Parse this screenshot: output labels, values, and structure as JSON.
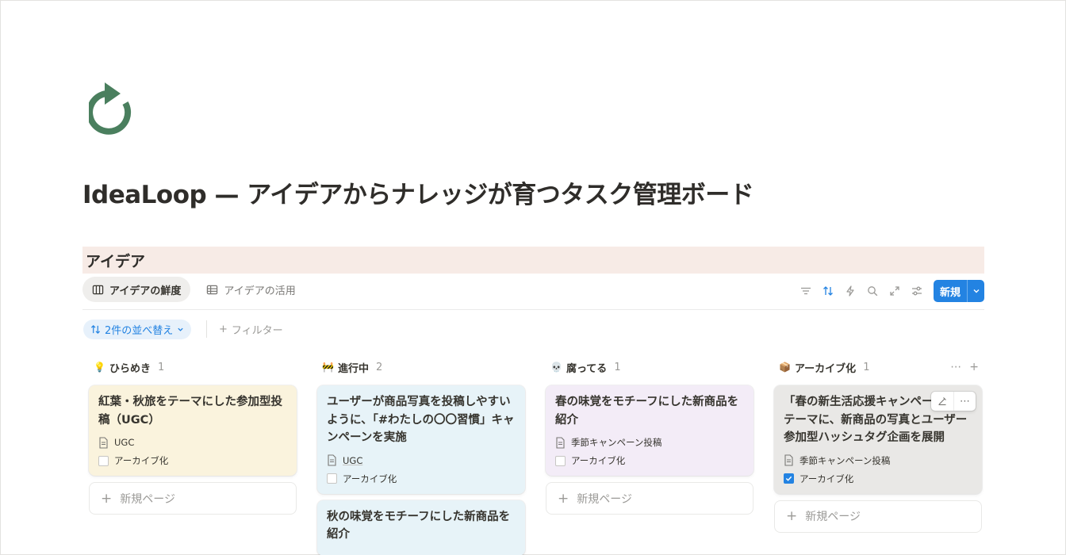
{
  "page": {
    "icon": "refresh-arrow-icon",
    "title": "IdeaLoop — アイデアからナレッジが育つタスク管理ボード"
  },
  "database": {
    "title": "アイデア",
    "views": [
      {
        "label": "アイデアの鮮度",
        "icon": "board-icon",
        "active": true
      },
      {
        "label": "アイデアの活用",
        "icon": "table-icon",
        "active": false
      }
    ],
    "new_button_label": "新規",
    "sort_chip_label": "2件の並べ替え",
    "filter_label": "フィルター"
  },
  "colors": {
    "accent": "#2383e2",
    "icon_green": "#4a7f5e",
    "db_title_bg": "#f7ebe6"
  },
  "columns": [
    {
      "emoji": "💡",
      "name": "ひらめき",
      "count": "1",
      "cards": [
        {
          "title": "紅葉・秋旅をテーマにした参加型投稿（UGC）",
          "tag": "UGC",
          "archive_label": "アーカイブ化",
          "archived": false,
          "bg": "#faf3dd"
        }
      ],
      "new_page_label": "新規ページ"
    },
    {
      "emoji": "🚧",
      "name": "進行中",
      "count": "2",
      "cards": [
        {
          "title": "ユーザーが商品写真を投稿しやすいように、「#わたしの〇〇習慣」キャンペーンを実施",
          "tag": "UGC",
          "archive_label": "アーカイブ化",
          "archived": false,
          "bg": "#e7f3f8"
        },
        {
          "title": "秋の味覚をモチーフにした新商品を紹介",
          "bg": "#e7f3f8"
        }
      ]
    },
    {
      "emoji": "💀",
      "name": "腐ってる",
      "count": "1",
      "cards": [
        {
          "title": "春の味覚をモチーフにした新商品を紹介",
          "tag": "季節キャンペーン投稿",
          "archive_label": "アーカイブ化",
          "archived": false,
          "bg": "#f3ecf7"
        }
      ],
      "new_page_label": "新規ページ"
    },
    {
      "emoji": "📦",
      "name": "アーカイブ化",
      "count": "1",
      "cards": [
        {
          "title": "「春の新生活応援キャンペーン」をテーマに、新商品の写真とユーザー参加型ハッシュタグ企画を展開",
          "tag": "季節キャンペーン投稿",
          "archive_label": "アーカイブ化",
          "archived": true,
          "bg": "#e9e8e6"
        }
      ],
      "new_page_label": "新規ページ"
    }
  ]
}
